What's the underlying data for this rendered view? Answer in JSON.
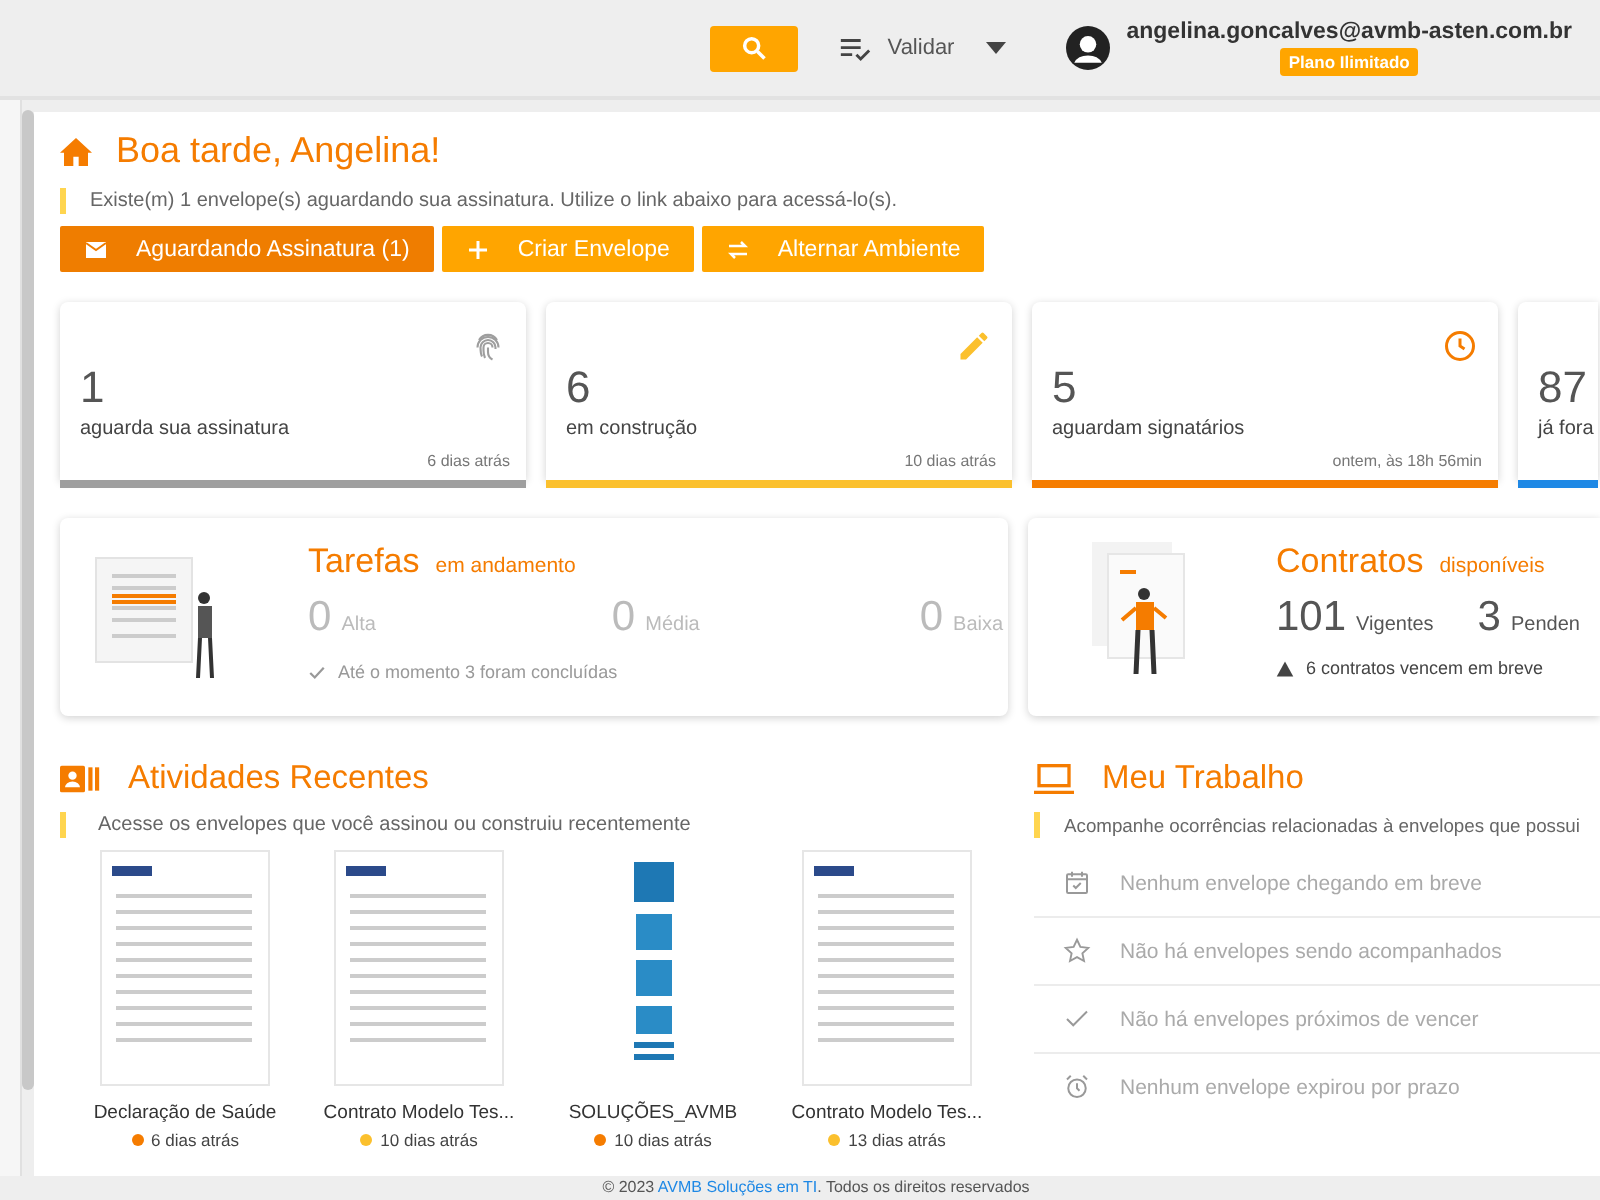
{
  "header": {
    "validate_label": "Validar",
    "user_email": "angelina.goncalves@avmb-asten.com.br",
    "plan_badge": "Plano Ilimitado"
  },
  "greeting": "Boa tarde, Angelina!",
  "notice": "Existe(m) 1 envelope(s) aguardando sua assinatura. Utilize o link abaixo para acessá-lo(s).",
  "actions": [
    {
      "label": "Aguardando Assinatura (1)",
      "color": "#ef7d00"
    },
    {
      "label": "Criar Envelope",
      "color": "#ffa500"
    },
    {
      "label": "Alternar Ambiente",
      "color": "#ffa500"
    }
  ],
  "stats": [
    {
      "value": "1",
      "label": "aguarda sua assinatura",
      "time": "6 dias atrás",
      "color": "#9e9e9e"
    },
    {
      "value": "6",
      "label": "em construção",
      "time": "10 dias atrás",
      "color": "#fbc02d"
    },
    {
      "value": "5",
      "label": "aguardam signatários",
      "time": "ontem, às 18h 56min",
      "color": "#f57c00"
    },
    {
      "value": "87",
      "label": "já fora",
      "color": "#1e88e5"
    }
  ],
  "tasks": {
    "title": "Tarefas",
    "subtitle": "em andamento",
    "counts": [
      {
        "value": "0",
        "label": "Alta"
      },
      {
        "value": "0",
        "label": "Média"
      },
      {
        "value": "0",
        "label": "Baixa"
      }
    ],
    "note": "Até o momento 3 foram concluídas"
  },
  "contracts": {
    "title": "Contratos",
    "subtitle": "disponíveis",
    "counts": [
      {
        "value": "101",
        "label": "Vigentes"
      },
      {
        "value": "3",
        "label": "Penden"
      }
    ],
    "note": "6 contratos vencem em breve"
  },
  "recent": {
    "title": "Atividades Recentes",
    "subtitle": "Acesse os envelopes que você assinou ou construiu recentemente",
    "items": [
      {
        "name": "Declaração de Saúde",
        "time": "6 dias atrás",
        "color": "#f57c00",
        "kind": "document"
      },
      {
        "name": "Contrato Modelo Tes...",
        "time": "10 dias atrás",
        "color": "#fbc02d",
        "kind": "document"
      },
      {
        "name": "SOLUÇÕES_AVMB",
        "time": "10 dias atrás",
        "color": "#f57c00",
        "kind": "infographic"
      },
      {
        "name": "Contrato Modelo Tes...",
        "time": "13 dias atrás",
        "color": "#fbc02d",
        "kind": "document"
      }
    ]
  },
  "work": {
    "title": "Meu Trabalho",
    "subtitle": "Acompanhe ocorrências relacionadas à envelopes que possui",
    "items": [
      "Nenhum envelope chegando em breve",
      "Não há envelopes sendo acompanhados",
      "Não há envelopes próximos de vencer",
      "Nenhum envelope expirou por prazo"
    ]
  },
  "footer": {
    "prefix": "© 2023",
    "link": "AVMB Soluções em TI",
    "suffix": ". Todos os direitos reservados"
  }
}
